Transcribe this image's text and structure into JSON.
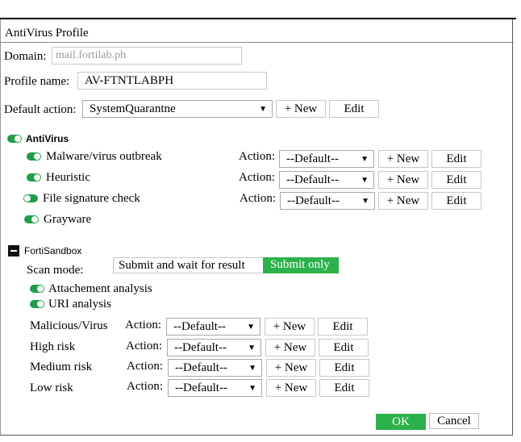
{
  "window": {
    "title": "AntiVirus Profile"
  },
  "domain": {
    "label": "Domain:",
    "value": "mail.fortilab.ph"
  },
  "profile": {
    "label": "Profile name:",
    "value": "AV-FTNTLABPH"
  },
  "default_action": {
    "label": "Default action:",
    "value": "SystemQuarantne",
    "new_label": "+ New",
    "edit_label": "Edit"
  },
  "antivirus": {
    "label": "AntiVirus",
    "rows": [
      {
        "label": "Malware/virus outbreak",
        "action_label": "Action:",
        "value": "--Default--",
        "new_label": "+ New",
        "edit_label": "Edit",
        "enabled": true
      },
      {
        "label": "Heuristic",
        "action_label": "Action:",
        "value": "--Default--",
        "new_label": "+ New",
        "edit_label": "Edit",
        "enabled": true
      },
      {
        "label": "File signature check",
        "action_label": "Action:",
        "value": "--Default--",
        "new_label": "+ New",
        "edit_label": "Edit",
        "enabled": false
      }
    ],
    "grayware_label": "Grayware"
  },
  "sandbox": {
    "label": "FortiSandbox",
    "scan_mode_label": "Scan mode:",
    "scan_modes": [
      "Submit and wait for result",
      "Submit only"
    ],
    "selected_mode": "Submit only",
    "attachment_label": "Attachement analysis",
    "uri_label": "URI analysis",
    "rows": [
      {
        "label": "Malicious/Virus",
        "action_label": "Action:",
        "value": "--Default--",
        "new_label": "+ New",
        "edit_label": "Edit"
      },
      {
        "label": "High risk",
        "action_label": "Action:",
        "value": "--Default--",
        "new_label": "+ New",
        "edit_label": "Edit"
      },
      {
        "label": "Medium risk",
        "action_label": "Action:",
        "value": "--Default--",
        "new_label": "+ New",
        "edit_label": "Edit"
      },
      {
        "label": "Low risk",
        "action_label": "Action:",
        "value": "--Default--",
        "new_label": "+ New",
        "edit_label": "Edit"
      }
    ]
  },
  "footer": {
    "ok_label": "OK",
    "cancel_label": "Cancel"
  },
  "colors": {
    "accent": "#2bb24c",
    "toggle": "#1e9e4a"
  }
}
